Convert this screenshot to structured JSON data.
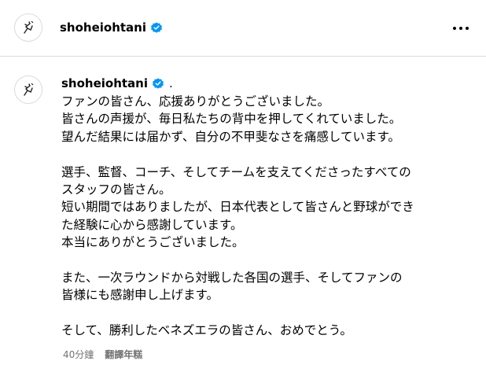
{
  "header": {
    "username": "shoheiohtani",
    "more_icon": "more-horizontal-icon"
  },
  "post": {
    "username": "shoheiohtani",
    "after_badge": ".",
    "caption_lines": [
      "ファンの皆さん、応援ありがとうございました。",
      "皆さんの声援が、毎日私たちの背中を押してくれていました。",
      "望んだ結果には届かず、自分の不甲斐なさを痛感しています。",
      "",
      "選手、監督、コーチ、そしてチームを支えてくださったすべての",
      "スタッフの皆さん。",
      "短い期間ではありましたが、日本代表として皆さんと野球ができ",
      "た経験に心から感謝しています。",
      "本当にありがとうございました。",
      "",
      "また、一次ラウンドから対戦した各国の選手、そしてファンの",
      "皆様にも感謝申し上げます。",
      "",
      "そして、勝利したベネズエラの皆さん、おめでとう。"
    ],
    "time": "40分鐘",
    "translate_label": "翻譯年糕"
  },
  "colors": {
    "verified": "#0095f6",
    "meta_text": "#737373",
    "divider": "#dbdbdb"
  }
}
